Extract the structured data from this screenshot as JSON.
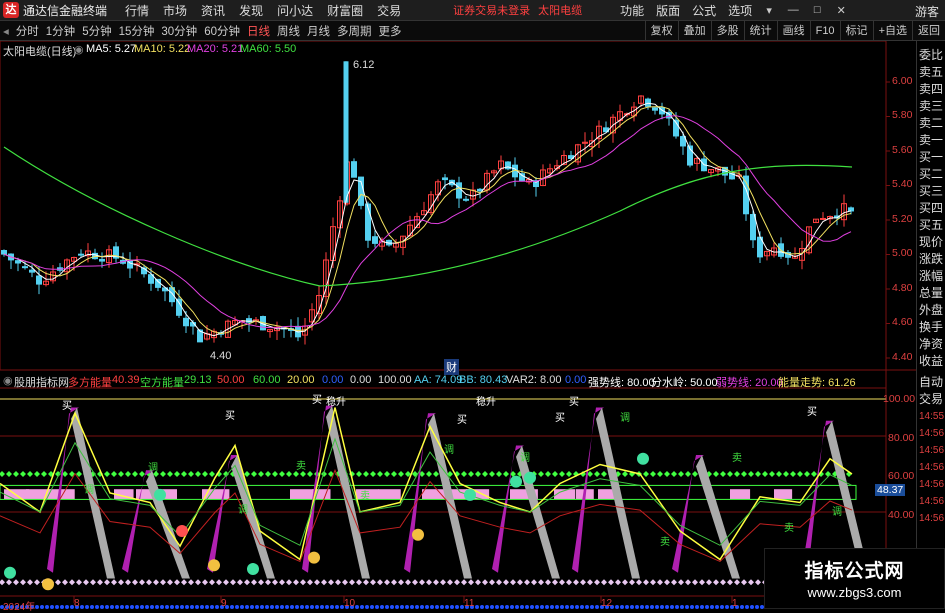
{
  "app": {
    "logo": "达",
    "name": "通达信金融终端",
    "menus": [
      "行情",
      "市场",
      "资讯",
      "发现",
      "问小达",
      "财富圈",
      "交易"
    ],
    "status": "证券交易未登录",
    "stock_title": "太阳电缆",
    "right_menus": [
      "功能",
      "版面",
      "公式",
      "选项"
    ],
    "guest": "游客",
    "win_icons": [
      "▾",
      "—",
      "□",
      "✕"
    ]
  },
  "periods": {
    "items": [
      "分时",
      "1分钟",
      "5分钟",
      "15分钟",
      "30分钟",
      "60分钟",
      "日线",
      "周线",
      "月线",
      "多周期",
      "更多"
    ],
    "active": "日线"
  },
  "right_tools": [
    "复权",
    "叠加",
    "多股",
    "统计",
    "画线",
    "F10",
    "标记",
    "+自选",
    "返回"
  ],
  "main_chart": {
    "title": "太阳电缆(日线)",
    "ma5": "MA5: 5.27",
    "ma10": "MA10: 5.22",
    "ma20": "MA20: 5.21",
    "ma60": "MA60: 5.50",
    "high_label": "6.12",
    "low_label": "4.40",
    "cai": "财"
  },
  "y_axis": [
    "6.00",
    "5.80",
    "5.60",
    "5.40",
    "5.20",
    "5.00",
    "4.80",
    "4.60",
    "4.40"
  ],
  "indicator": {
    "name": "股朋指标网",
    "dual": "多方能量",
    "dual_val": "40.39",
    "kong": "空方能量",
    "kong_val": "29.13",
    "v50": "50.00",
    "v60": "60.00",
    "v20": "20.00",
    "v0": "0.00",
    "v0b": "0.00",
    "v100": "100.00",
    "aa": "AA: 74.09",
    "bb": "BB: 80.43",
    "var2": "VAR2: 8.00",
    "v00": "0.00",
    "strong": "强势线: 80.00",
    "divide": "分水岭: 50.00",
    "weak": "弱势线: 20.00",
    "trend": "能量走势: 61.26",
    "current": "48.37",
    "y_axis": [
      "100.00",
      "80.00",
      "60.00",
      "40.00"
    ],
    "annotations": {
      "buy": "买",
      "adj": "调",
      "sell": "卖",
      "stable": "稳升"
    }
  },
  "right_panel": [
    "委比",
    "卖五",
    "卖四",
    "卖三",
    "卖二",
    "卖一",
    "买一",
    "买二",
    "买三",
    "买四",
    "买五",
    "现价",
    "涨跌",
    "涨幅",
    "总量",
    "外盘",
    "换手",
    "净资",
    "收益",
    "",
    "自动",
    "交易"
  ],
  "right_clock": [
    "14:55",
    "14:56",
    "14:56",
    "14:56",
    "14:56",
    "14:56",
    "14:56",
    "14:56",
    "14:56"
  ],
  "x_axis": [
    "2024年",
    "8",
    "9",
    "10",
    "11",
    "12",
    "1"
  ],
  "watermark": {
    "title": "指标公式网",
    "url": "www.zbgs3.com"
  },
  "colors": {
    "up": "#ff4040",
    "down": "#54d0f0",
    "ma5": "#ffffff",
    "ma10": "#f2e060",
    "ma20": "#e040e0",
    "ma60": "#40e040",
    "bg": "#000000",
    "grid": "#7a1010"
  }
}
